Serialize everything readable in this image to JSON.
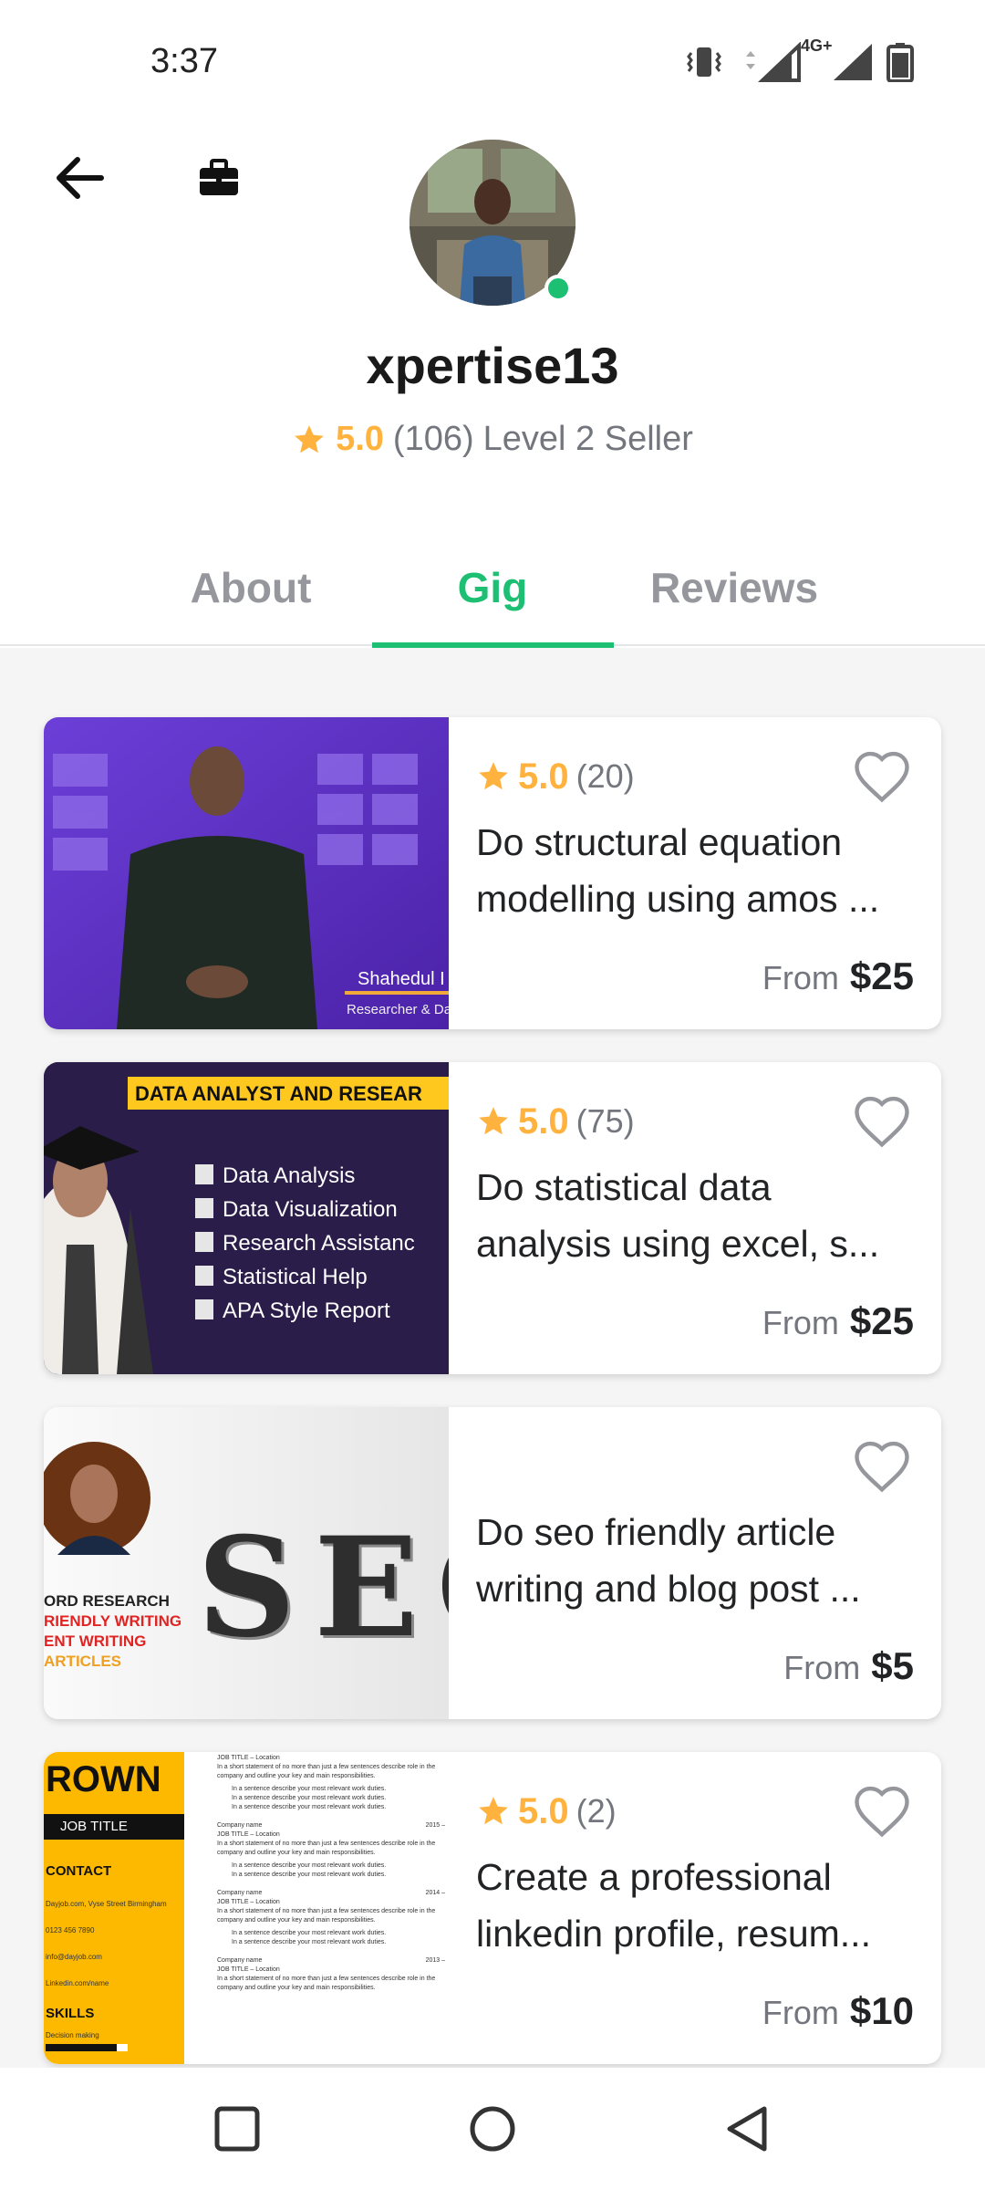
{
  "status_bar": {
    "time": "3:37",
    "network": "4G+"
  },
  "header": {
    "username": "xpertise13",
    "rating": "5.0",
    "rating_count": "(106)",
    "seller_level": "Level 2 Seller",
    "online": true
  },
  "tabs": [
    {
      "label": "About",
      "active": false
    },
    {
      "label": "Gig",
      "active": true
    },
    {
      "label": "Reviews",
      "active": false
    }
  ],
  "gigs": [
    {
      "rating": "5.0",
      "rating_count": "(20)",
      "title": "Do structural equation modelling using amos ...",
      "from_label": "From",
      "price": "$25",
      "thumb_text": [
        "Shahedul I",
        "Researcher & Da"
      ]
    },
    {
      "rating": "5.0",
      "rating_count": "(75)",
      "title": "Do statistical data analysis using excel, s...",
      "from_label": "From",
      "price": "$25",
      "thumb_banner": "DATA  ANALYST AND RESEAR",
      "thumb_items": [
        "Data Analysis",
        "Data Visualization",
        "Research Assistanc",
        "Statistical Help",
        "APA Style Report"
      ]
    },
    {
      "rating": "",
      "rating_count": "",
      "title": "Do seo friendly article writing and blog post ...",
      "from_label": "From",
      "price": "$5",
      "thumb_word": "SEO",
      "thumb_lines": [
        "ORD RESEARCH",
        "RIENDLY WRITING",
        "ENT WRITING",
        "ARTICLES"
      ]
    },
    {
      "rating": "5.0",
      "rating_count": "(2)",
      "title": "Create a professional linkedin profile, resum...",
      "from_label": "From",
      "price": "$10",
      "thumb_name": "ROWN",
      "thumb_jobtitle": "JOB TITLE",
      "thumb_contact": "CONTACT",
      "thumb_contact_lines": [
        "Dayjob.com, Vyse Street Birmingham",
        "0123 456 7890",
        "info@dayjob.com",
        "Linkedin.com/name"
      ],
      "thumb_skills": "SKILLS",
      "thumb_skill1": "Decision making",
      "thumb_resume_heading": "JOB TITLE – Location",
      "thumb_resume_text": "In a short statement of no more than just a few sentences describe role in the company and outline your key and main responsibilities.",
      "thumb_resume_bullet": "In a sentence describe your most relevant work duties.",
      "thumb_company": "Company name",
      "thumb_years": [
        "2015 –",
        "2014 –",
        "2013 –"
      ]
    }
  ],
  "colors": {
    "accent_green": "#1dbf73",
    "star_gold": "#ffb33e",
    "muted_text": "#74767e",
    "list_bg": "#f5f5f5"
  },
  "icons": {
    "back": "arrow-left-icon",
    "briefcase": "briefcase-icon",
    "star": "star-icon",
    "heart": "heart-outline-icon",
    "nav_recents": "square-icon",
    "nav_home": "circle-icon",
    "nav_back": "triangle-back-icon"
  }
}
